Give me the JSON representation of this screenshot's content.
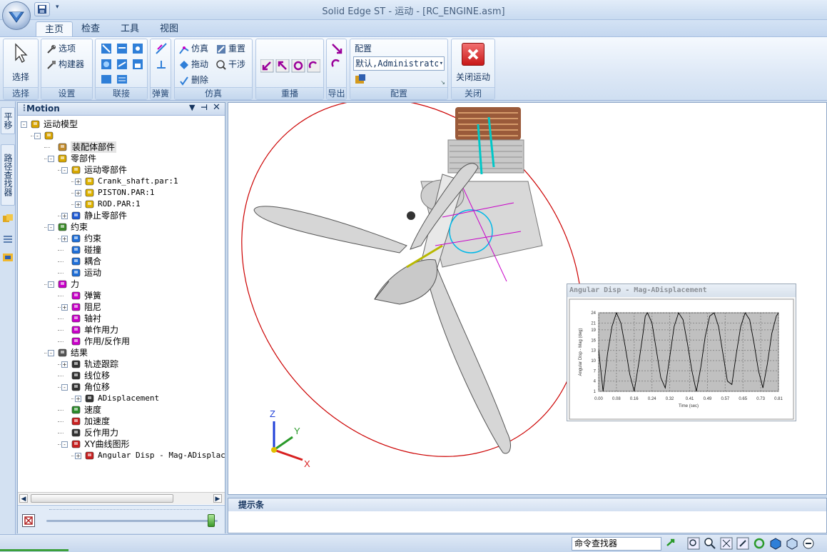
{
  "window": {
    "title": "Solid Edge ST - 运动 - [RC_ENGINE.asm]"
  },
  "tabs": [
    {
      "label": "主页",
      "active": true
    },
    {
      "label": "检查",
      "active": false
    },
    {
      "label": "工具",
      "active": false
    },
    {
      "label": "视图",
      "active": false
    }
  ],
  "ribbon": {
    "select": {
      "button": "选择",
      "group": "选择"
    },
    "settings": {
      "options": "选项",
      "builder": "构建器",
      "group": "设置"
    },
    "joints": {
      "group": "联接"
    },
    "spring": {
      "group": "弹簧"
    },
    "simulation": {
      "simulate": "仿真",
      "reset": "重置",
      "drag": "拖动",
      "interference": "干涉",
      "delete": "删除",
      "group": "仿真"
    },
    "replay": {
      "group": "重播"
    },
    "export": {
      "group": "导出"
    },
    "config": {
      "label": "配置",
      "select_value": "默认,Administrato",
      "group": "配置"
    },
    "close": {
      "button": "关闭运动",
      "group": "关闭"
    }
  },
  "side_tabs": [
    "平移",
    "路径查找器"
  ],
  "panel": {
    "title": "Motion",
    "tree": [
      {
        "label": "运动模型",
        "level": 0,
        "exp": "-",
        "icon": "motion-model-icon",
        "color": "#d9a400"
      },
      {
        "label": "",
        "level": 1,
        "exp": "-",
        "icon": "motion-gear-icon",
        "color": "#d9a400"
      },
      {
        "label": "装配体部件",
        "level": 2,
        "exp": "",
        "icon": "assembly-icon",
        "color": "#c28b2b",
        "selected": true
      },
      {
        "label": "零部件",
        "level": 2,
        "exp": "-",
        "icon": "parts-icon",
        "color": "#d8a800"
      },
      {
        "label": "运动零部件",
        "level": 3,
        "exp": "-",
        "icon": "moving-parts-icon",
        "color": "#d8a800"
      },
      {
        "label": "Crank_shaft.par:1",
        "level": 4,
        "exp": "+",
        "icon": "part-icon",
        "color": "#e0b400",
        "mono": true
      },
      {
        "label": "PISTON.PAR:1",
        "level": 4,
        "exp": "+",
        "icon": "part-icon",
        "color": "#e0b400",
        "mono": true
      },
      {
        "label": "ROD.PAR:1",
        "level": 4,
        "exp": "+",
        "icon": "part-icon",
        "color": "#e0b400",
        "mono": true
      },
      {
        "label": "静止零部件",
        "level": 3,
        "exp": "+",
        "icon": "ground-parts-icon",
        "color": "#1f5bd6"
      },
      {
        "label": "约束",
        "level": 2,
        "exp": "-",
        "icon": "constraints-icon",
        "color": "#3c8c2a"
      },
      {
        "label": "约束",
        "level": 3,
        "exp": "+",
        "icon": "joint-icon",
        "color": "#1f6fd8"
      },
      {
        "label": "碰撞",
        "level": 3,
        "exp": "",
        "icon": "contact-icon",
        "color": "#1f6fd8"
      },
      {
        "label": "耦合",
        "level": 3,
        "exp": "",
        "icon": "coupler-icon",
        "color": "#1f6fd8"
      },
      {
        "label": "运动",
        "level": 3,
        "exp": "",
        "icon": "motion-icon",
        "color": "#1f6fd8"
      },
      {
        "label": "力",
        "level": 2,
        "exp": "-",
        "icon": "forces-icon",
        "color": "#c800c8"
      },
      {
        "label": "弹簧",
        "level": 3,
        "exp": "",
        "icon": "spring-icon",
        "color": "#c800c8"
      },
      {
        "label": "阻尼",
        "level": 3,
        "exp": "+",
        "icon": "damper-icon",
        "color": "#c800c8"
      },
      {
        "label": "轴衬",
        "level": 3,
        "exp": "",
        "icon": "bushing-icon",
        "color": "#c800c8"
      },
      {
        "label": "单作用力",
        "level": 3,
        "exp": "",
        "icon": "single-force-icon",
        "color": "#c800c8"
      },
      {
        "label": "作用/反作用",
        "level": 3,
        "exp": "",
        "icon": "action-reaction-icon",
        "color": "#c800c8"
      },
      {
        "label": "结果",
        "level": 2,
        "exp": "-",
        "icon": "results-icon",
        "color": "#555555"
      },
      {
        "label": "轨迹跟踪",
        "level": 3,
        "exp": "+",
        "icon": "trace-icon",
        "color": "#333333"
      },
      {
        "label": "线位移",
        "level": 3,
        "exp": "",
        "icon": "linear-disp-icon",
        "color": "#333333"
      },
      {
        "label": "角位移",
        "level": 3,
        "exp": "-",
        "icon": "angular-disp-icon",
        "color": "#333333"
      },
      {
        "label": "ADisplacement",
        "level": 4,
        "exp": "+",
        "icon": "measure-icon",
        "color": "#333333",
        "mono": true
      },
      {
        "label": "速度",
        "level": 3,
        "exp": "",
        "icon": "velocity-icon",
        "color": "#2a8a2a"
      },
      {
        "label": "加速度",
        "level": 3,
        "exp": "",
        "icon": "acceleration-icon",
        "color": "#c82020"
      },
      {
        "label": "反作用力",
        "level": 3,
        "exp": "",
        "icon": "reaction-force-icon",
        "color": "#333333"
      },
      {
        "label": "XY曲线图形",
        "level": 3,
        "exp": "-",
        "icon": "xy-plot-icon",
        "color": "#c82020"
      },
      {
        "label": "Angular Disp - Mag-ADisplacement",
        "level": 4,
        "exp": "+",
        "icon": "plot-icon",
        "color": "#c82020",
        "mono": true
      }
    ]
  },
  "graph": {
    "title": "Angular Disp - Mag-ADisplacement",
    "chart_data": {
      "type": "line",
      "title": "",
      "xlabel": "Time (sec)",
      "ylabel": "Angular Disp - Mag (deg)",
      "x_ticks": [
        "0.00",
        "0.08",
        "0.16",
        "0.24",
        "0.32",
        "0.41",
        "0.49",
        "0.57",
        "0.65",
        "0.73",
        "0.81"
      ],
      "y_ticks": [
        "1",
        "4",
        "7",
        "10",
        "13",
        "16",
        "19",
        "21",
        "24"
      ],
      "xlim": [
        0,
        0.81
      ],
      "ylim": [
        1,
        24
      ],
      "grid": true,
      "series": [
        {
          "color": "#000000",
          "x": [
            0.0,
            0.02,
            0.04,
            0.06,
            0.08,
            0.1,
            0.12,
            0.14,
            0.16,
            0.18,
            0.2,
            0.21,
            0.22,
            0.24,
            0.26,
            0.28,
            0.3,
            0.32,
            0.34,
            0.36,
            0.38,
            0.4,
            0.42,
            0.44,
            0.46,
            0.48,
            0.5,
            0.52,
            0.54,
            0.56,
            0.58,
            0.6,
            0.62,
            0.64,
            0.66,
            0.68,
            0.7,
            0.72,
            0.74,
            0.76,
            0.78,
            0.8,
            0.81
          ],
          "y": [
            13,
            1,
            12,
            20,
            24,
            21,
            14,
            6,
            1,
            9,
            18,
            23,
            24,
            21,
            13,
            5,
            2,
            11,
            20,
            24,
            22,
            15,
            7,
            1,
            8,
            17,
            23,
            24,
            20,
            12,
            4,
            3,
            12,
            20,
            24,
            22,
            15,
            7,
            2,
            9,
            18,
            23,
            24
          ]
        }
      ]
    }
  },
  "axes_labels": {
    "z": "Z",
    "y": "Y",
    "x": "X"
  },
  "hint": {
    "title": "提示条"
  },
  "status": {
    "command_finder": "命令查找器"
  },
  "colors": {
    "accent": "#1f6fd8",
    "graph_bg": "#c0c0c0",
    "orbit": "#cc0000"
  }
}
